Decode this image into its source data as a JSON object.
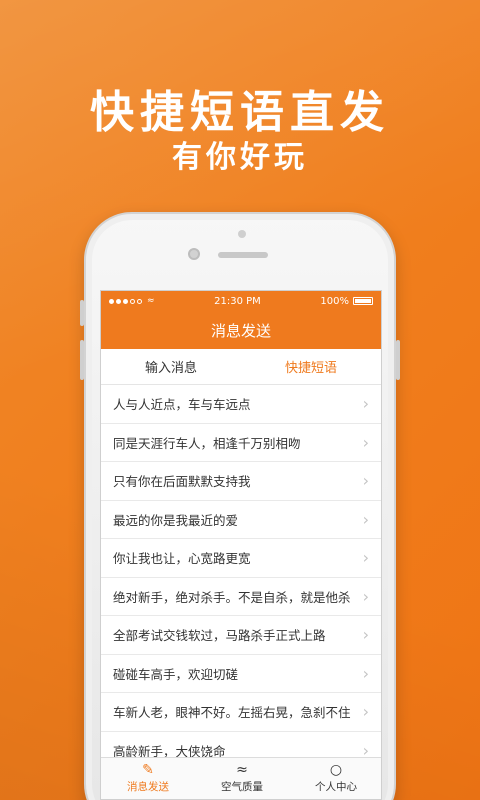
{
  "promo": {
    "headline": "快捷短语直发",
    "subheadline": "有你好玩"
  },
  "status_bar": {
    "time": "21:30 PM",
    "battery": "100%"
  },
  "nav_bar": {
    "title": "消息发送"
  },
  "tabs": [
    {
      "label": "输入消息",
      "active": false
    },
    {
      "label": "快捷短语",
      "active": true
    }
  ],
  "phrases": [
    "人与人近点，车与车远点",
    "同是天涯行车人，相逢千万别相吻",
    "只有你在后面默默支持我",
    "最远的你是我最近的爱",
    "你让我也让，心宽路更宽",
    "绝对新手，绝对杀手。不是自杀，就是他杀",
    "全部考试交钱软过，马路杀手正式上路",
    "碰碰车高手，欢迎切磋",
    "车新人老，眼神不好。左摇右晃，急刹不住",
    "高龄新手，大侠饶命"
  ],
  "tab_bar": [
    {
      "label": "消息发送",
      "icon": "edit-icon",
      "active": true
    },
    {
      "label": "空气质量",
      "icon": "wave-icon",
      "active": false
    },
    {
      "label": "个人中心",
      "icon": "person-icon",
      "active": false
    }
  ],
  "colors": {
    "accent": "#ef7a1e",
    "background": "#f08a2c"
  }
}
